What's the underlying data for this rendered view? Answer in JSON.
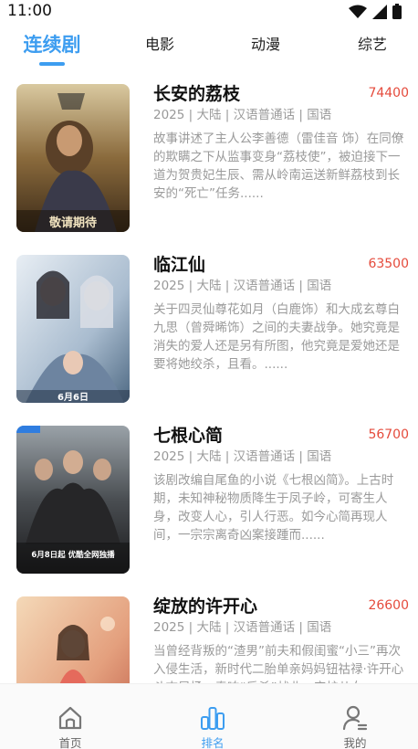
{
  "status_bar": {
    "time": "11:00"
  },
  "tabs": [
    {
      "label": "连续剧",
      "active": true
    },
    {
      "label": "电影",
      "active": false
    },
    {
      "label": "动漫",
      "active": false
    },
    {
      "label": "综艺",
      "active": false
    }
  ],
  "items": [
    {
      "title": "长安的荔枝",
      "score": "74400",
      "meta": "2025 | 大陆 | 汉语普通话 | 国语",
      "description": "故事讲述了主人公李善德（雷佳音 饰）在同僚的欺瞒之下从监事变身“荔枝使”，被迫接下一道为贺贵妃生辰、需从岭南运送新鲜荔枝到长安的“死亡”任务......",
      "poster_text": "敬请期待"
    },
    {
      "title": "临江仙",
      "score": "63500",
      "meta": "2025 | 大陆 | 汉语普通话 | 国语",
      "description": "关于四灵仙尊花如月（白鹿饰）和大成玄尊白九思（曾舜晞饰）之间的夫妻战争。她究竟是消失的爱人还是另有所图，他究竟是爱她还是要将她绞杀，且看。......",
      "poster_text": "6月6日"
    },
    {
      "title": "七根心简",
      "score": "56700",
      "meta": "2025 | 大陆 | 汉语普通话 | 国语",
      "description": "该剧改编自尾鱼的小说《七根凶简》。上古时期，未知神秘物质降生于凤子岭，可寄生人身，改变人心，引人行恶。如今心简再现人间，一宗宗离奇凶案接踵而......",
      "poster_text": "6月8日起 优酷全网独播"
    },
    {
      "title": "绽放的许开心",
      "score": "26600",
      "meta": "2025 | 大陆 | 汉语普通话 | 国语",
      "description": "当曾经背叛的“渣男”前夫和假闺蜜“小三”再次入侵生活，新时代二胎单亲妈妈钮祜禄·许开心斗志昂扬，奏响“反杀”战曲，守护儿女......",
      "poster_text": ""
    }
  ],
  "bottom_nav": [
    {
      "label": "首页",
      "icon": "home-icon",
      "active": false
    },
    {
      "label": "排名",
      "icon": "ranking-icon",
      "active": true
    },
    {
      "label": "我的",
      "icon": "profile-icon",
      "active": false
    }
  ],
  "colors": {
    "accent": "#3d9df0",
    "score": "#e54b3c",
    "muted": "#999999"
  }
}
